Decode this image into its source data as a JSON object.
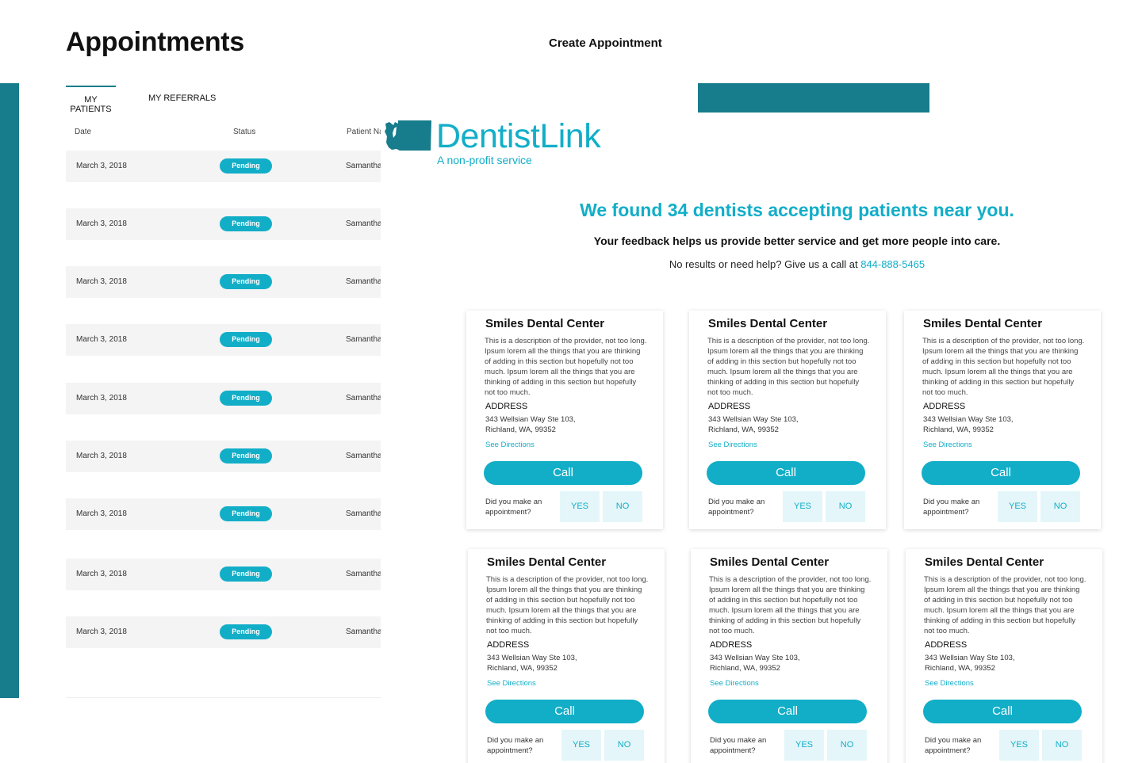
{
  "page": {
    "title": "Appointments",
    "create_link": "Create Appointment"
  },
  "tabs": [
    {
      "label": "MY PATIENTS",
      "active": true
    },
    {
      "label": "MY REFERRALS",
      "active": false
    }
  ],
  "table": {
    "headers": {
      "date": "Date",
      "status": "Status",
      "patient": "Patient Name"
    },
    "rows": [
      {
        "date": "March 3, 2018",
        "status": "Pending",
        "patient": "Samantha"
      },
      {
        "date": "March 3, 2018",
        "status": "Pending",
        "patient": "Samantha"
      },
      {
        "date": "March 3, 2018",
        "status": "Pending",
        "patient": "Samantha"
      },
      {
        "date": "March 3, 2018",
        "status": "Pending",
        "patient": "Samantha"
      },
      {
        "date": "March 3, 2018",
        "status": "Pending",
        "patient": "Samantha"
      },
      {
        "date": "March 3, 2018",
        "status": "Pending",
        "patient": "Samantha"
      },
      {
        "date": "March 3, 2018",
        "status": "Pending",
        "patient": "Samantha"
      },
      {
        "date": "March 3, 2018",
        "status": "Pending",
        "patient": "Samantha"
      },
      {
        "date": "March 3, 2018",
        "status": "Pending",
        "patient": "Samantha"
      }
    ]
  },
  "brand": {
    "name": "DentistLink",
    "tagline": "A non-profit service",
    "logo_icon": "washington-state-icon"
  },
  "results": {
    "headline": "We found 34 dentists accepting patients near you.",
    "feedback": "Your feedback helps us provide better service and get more people into care.",
    "help_prefix": "No results or need help? Give us a call at ",
    "phone": "844-888-5465"
  },
  "card_labels": {
    "address": "ADDRESS",
    "directions": "See Directions",
    "call": "Call",
    "question": "Did you make an appointment?",
    "yes": "YES",
    "no": "NO"
  },
  "cards": [
    {
      "name": "Smiles Dental Center",
      "description": "This is a description of the provider, not too long. Ipsum lorem all the things that you are thinking of adding in this section but hopefully not too much. Ipsum lorem all the things that you are thinking of adding in this section but hopefully not too much.",
      "address_line1": "343 Wellsian Way Ste 103,",
      "address_line2": "Richland, WA, 99352"
    },
    {
      "name": "Smiles Dental Center",
      "description": "This is a description of the provider, not too long. Ipsum lorem all the things that you are thinking of adding in this section but hopefully not too much. Ipsum lorem all the things that you are thinking of adding in this section but hopefully not too much.",
      "address_line1": "343 Wellsian Way Ste 103,",
      "address_line2": "Richland, WA, 99352"
    },
    {
      "name": "Smiles Dental Center",
      "description": "This is a description of the provider, not too long. Ipsum lorem all the things that you are thinking of adding in this section but hopefully not too much. Ipsum lorem all the things that you are thinking of adding in this section but hopefully not too much.",
      "address_line1": "343 Wellsian Way Ste 103,",
      "address_line2": "Richland, WA, 99352"
    },
    {
      "name": "Smiles Dental Center",
      "description": "This is a description of the provider, not too long. Ipsum lorem all the things that you are thinking of adding in this section but hopefully not too much. Ipsum lorem all the things that you are thinking of adding in this section but hopefully not too much.",
      "address_line1": "343 Wellsian Way Ste 103,",
      "address_line2": "Richland, WA, 99352"
    },
    {
      "name": "Smiles Dental Center",
      "description": "This is a description of the provider, not too long. Ipsum lorem all the things that you are thinking of adding in this section but hopefully not too much. Ipsum lorem all the things that you are thinking of adding in this section but hopefully not too much.",
      "address_line1": "343 Wellsian Way Ste 103,",
      "address_line2": "Richland, WA, 99352"
    },
    {
      "name": "Smiles Dental Center",
      "description": "This is a description of the provider, not too long. Ipsum lorem all the things that you are thinking of adding in this section but hopefully not too much. Ipsum lorem all the things that you are thinking of adding in this section but hopefully not too much.",
      "address_line1": "343 Wellsian Way Ste 103,",
      "address_line2": "Richland, WA, 99352"
    }
  ],
  "colors": {
    "accent": "#12aec8",
    "dark_teal": "#177c8c",
    "button_soft": "#e4f6f9",
    "row_bg": "#f4f4f4"
  }
}
